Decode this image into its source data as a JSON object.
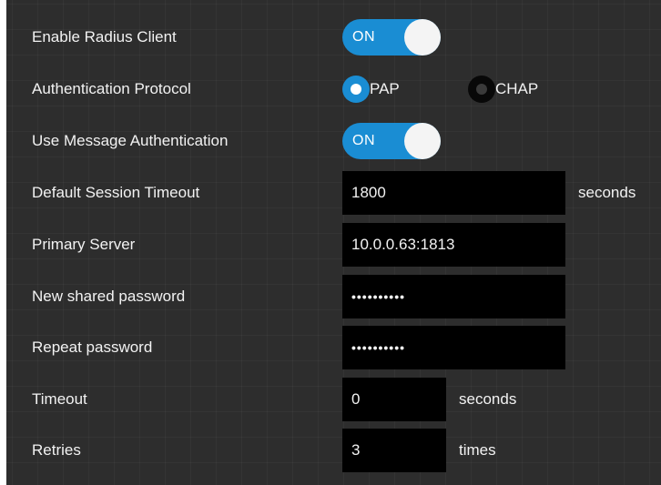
{
  "colors": {
    "panel_background": "#2d2d2d",
    "accent": "#1a8dd3",
    "field_background": "#000000",
    "text": "#f2f2f2"
  },
  "enable_radius_client": {
    "label": "Enable Radius Client",
    "toggle_text": "ON",
    "state": "on"
  },
  "authentication_protocol": {
    "label": "Authentication Protocol",
    "options": [
      {
        "label": "PAP",
        "selected": true
      },
      {
        "label": "CHAP",
        "selected": false
      }
    ]
  },
  "use_message_authentication": {
    "label": "Use Message Authentication",
    "toggle_text": "ON",
    "state": "on"
  },
  "default_session_timeout": {
    "label": "Default Session Timeout",
    "value": "1800",
    "unit": "seconds"
  },
  "primary_server": {
    "label": "Primary Server",
    "value": "10.0.0.63:1813"
  },
  "new_shared_password": {
    "label": "New shared password",
    "value": "••••••••••"
  },
  "repeat_password": {
    "label": "Repeat password",
    "value": "••••••••••"
  },
  "timeout": {
    "label": "Timeout",
    "value": "0",
    "unit": "seconds"
  },
  "retries": {
    "label": "Retries",
    "value": "3",
    "unit": "times"
  }
}
